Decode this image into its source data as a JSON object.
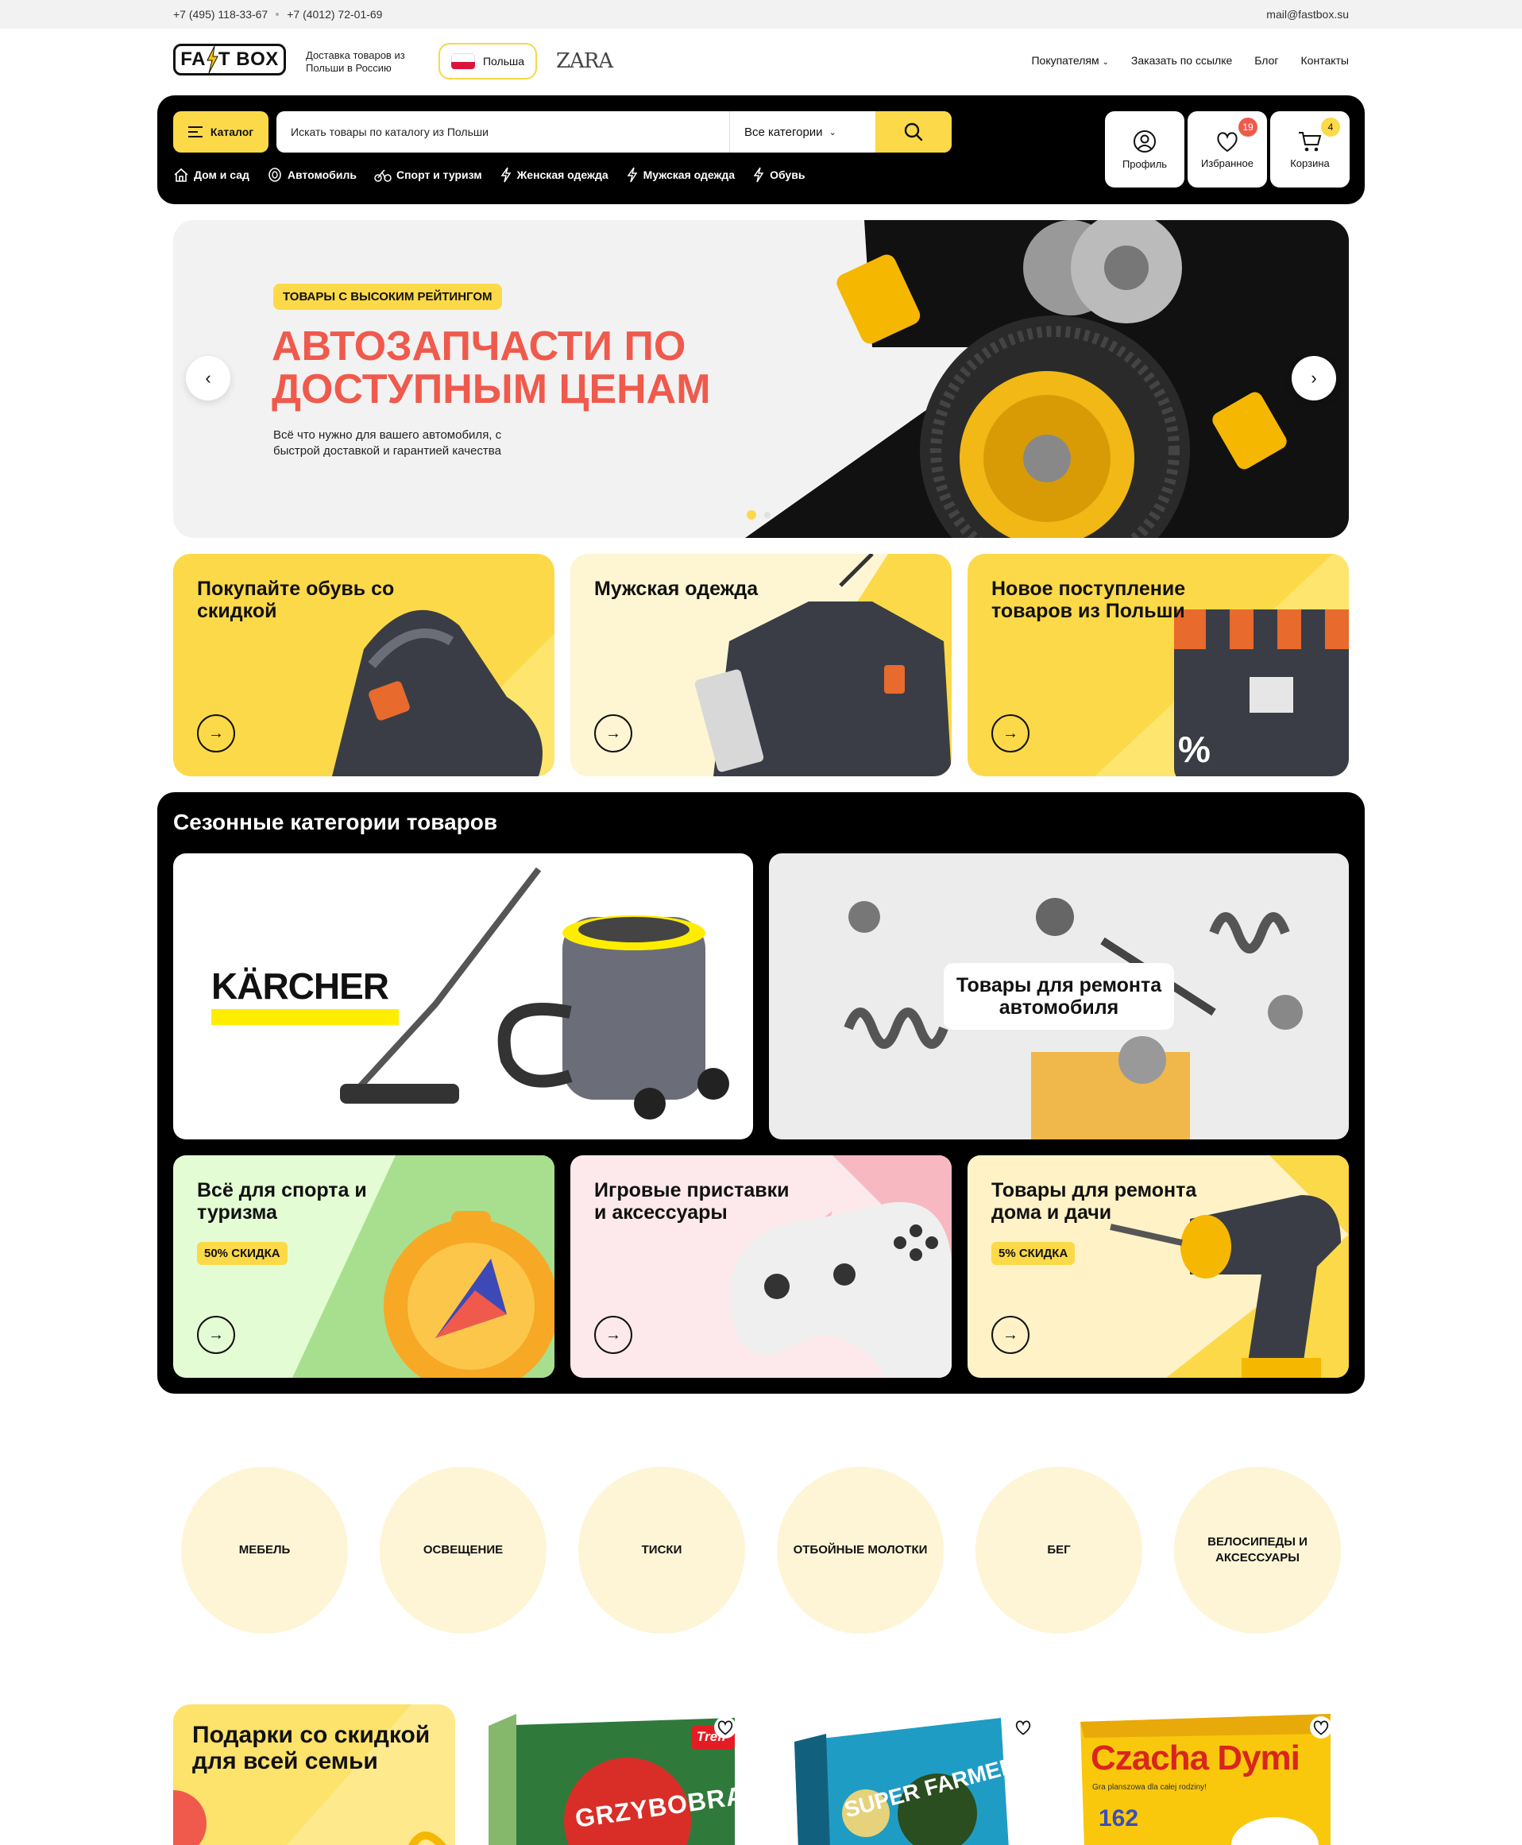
{
  "topbar": {
    "phone1": "+7 (495) 118-33-67",
    "phone2": "+7 (4012) 72-01-69",
    "email": "mail@fastbox.su"
  },
  "header": {
    "logo_text_a": "FA",
    "logo_text_b": "T BOX",
    "tagline": "Доставка товаров из Польши в Россию",
    "country": "Польша",
    "partner_logo": "ZARA",
    "nav": [
      "Покупателям",
      "Заказать по ссылке",
      "Блог",
      "Контакты"
    ]
  },
  "toolbar": {
    "catalog": "Каталог",
    "search_placeholder": "Искать товары по каталогу из Польши",
    "categories_select": "Все категории",
    "quick_links": [
      "Дом и сад",
      "Автомобиль",
      "Спорт и туризм",
      "Женская одежда",
      "Мужская одежда",
      "Обувь"
    ],
    "profile": "Профиль",
    "favorites": "Избранное",
    "favorites_count": "19",
    "cart": "Корзина",
    "cart_count": "4"
  },
  "hero": {
    "tag": "ТОВАРЫ С ВЫСОКИМ РЕЙТИНГОМ",
    "title": "АВТОЗАПЧАСТИ ПО ДОСТУПНЫМ ЦЕНАМ",
    "description": "Всё что нужно для вашего автомобиля, с быстрой доставкой и гарантией качества",
    "slide_count": 2,
    "active_slide": 1
  },
  "promos": [
    {
      "title": "Покупайте обувь со скидкой"
    },
    {
      "title": "Мужская одежда"
    },
    {
      "title": "Новое поступление товаров из Польши"
    }
  ],
  "season": {
    "title": "Сезонные категории товаров",
    "brand_card": "KÄRCHER",
    "repair_card": "Товары для ремонта автомобиля",
    "cards": [
      {
        "title": "Всё для спорта и туризма",
        "discount": "50% СКИДКА"
      },
      {
        "title": "Игровые приставки и аксессуары"
      },
      {
        "title": "Товары для ремонта дома и дачи",
        "discount": "5% СКИДКА"
      }
    ]
  },
  "round_categories": [
    "МЕБЕЛЬ",
    "ОСВЕЩЕНИЕ",
    "ТИСКИ",
    "ОТБОЙНЫЕ МОЛОТКИ",
    "БЕГ",
    "ВЕЛОСИПЕДЫ И АКСЕССУАРЫ"
  ],
  "gifts": {
    "title": "Подарки со скидкой для всей семьи",
    "products": [
      {
        "box_title": "GRZYBOBRANIE",
        "brand": "Trefl"
      },
      {
        "box_title": "SUPER FARMER"
      },
      {
        "box_title": "Czacha Dymi",
        "subtitle": "Gra planszowa dla całej rodziny!",
        "number": "162"
      }
    ]
  },
  "colors": {
    "accent": "#fcd948",
    "hero_title": "#ef5a4c",
    "badge_red": "#ef5a4c",
    "dark": "#000000",
    "soft_yellow": "#fef5d6"
  }
}
